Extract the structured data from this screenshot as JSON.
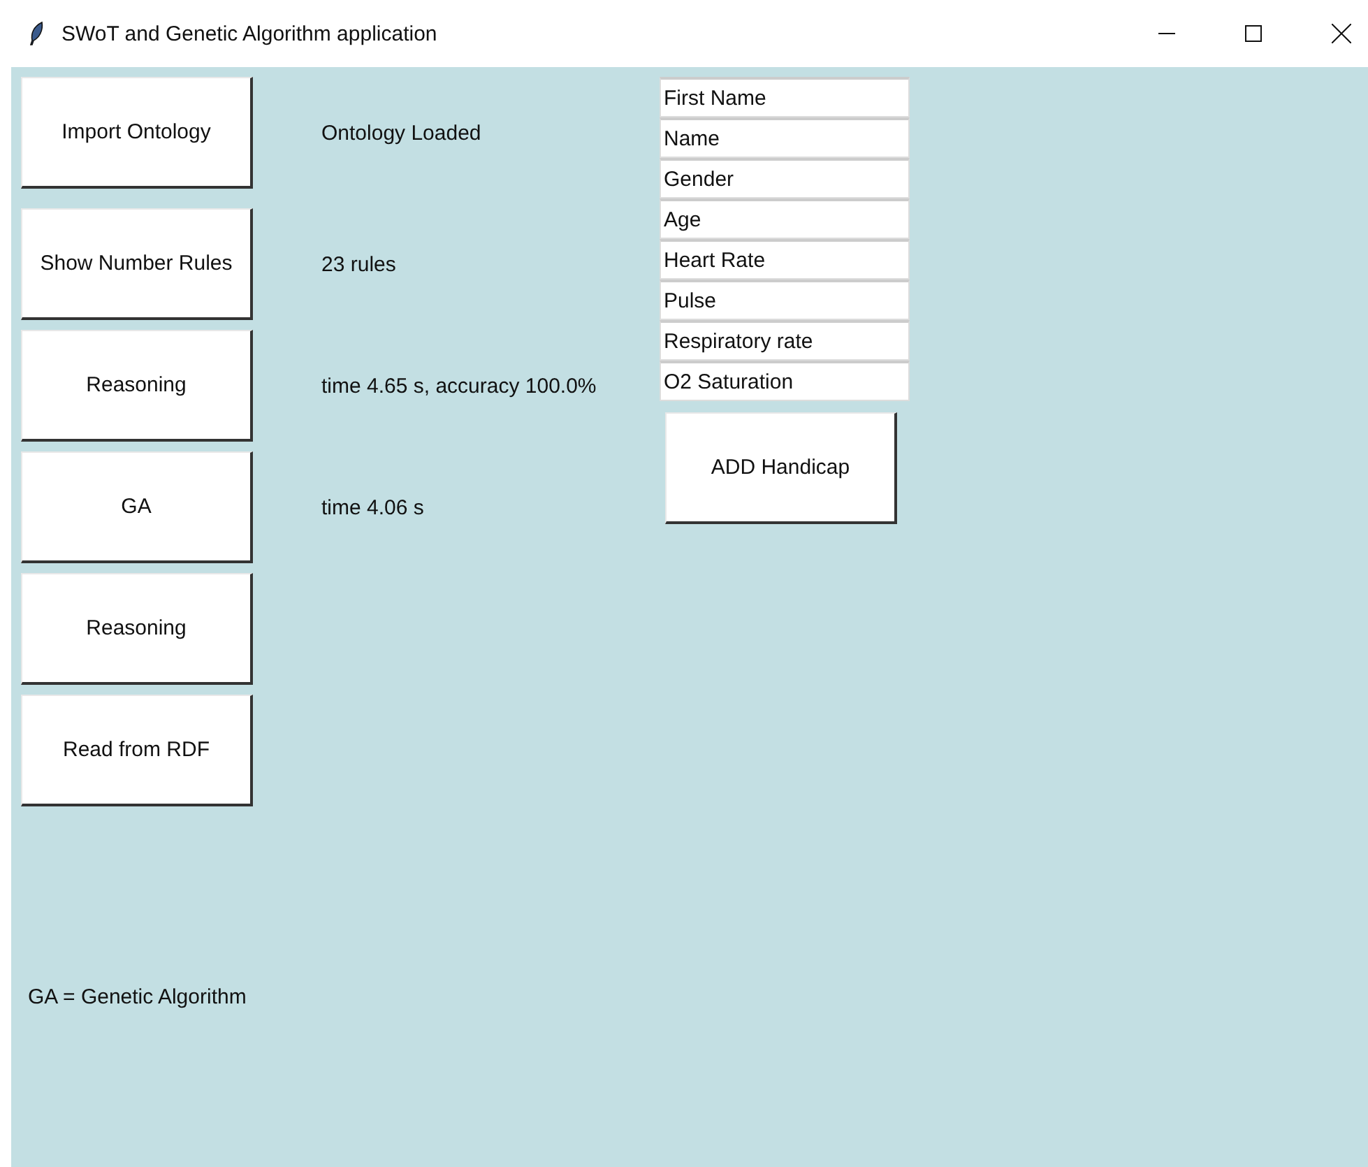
{
  "window": {
    "title": "SWoT and Genetic Algorithm application"
  },
  "actions": [
    {
      "label": "Import Ontology",
      "status": "Ontology Loaded"
    },
    {
      "label": "Show Number Rules",
      "status": "23 rules"
    },
    {
      "label": "Reasoning",
      "status": "time 4.65 s, accuracy 100.0%"
    },
    {
      "label": "GA",
      "status": "time 4.06 s"
    },
    {
      "label": "Reasoning"
    },
    {
      "label": "Read from RDF"
    }
  ],
  "fields": [
    {
      "value": "First Name"
    },
    {
      "value": "Name"
    },
    {
      "value": "Gender"
    },
    {
      "value": "Age"
    },
    {
      "value": "Heart Rate"
    },
    {
      "value": "Pulse"
    },
    {
      "value": "Respiratory rate"
    },
    {
      "value": "O2 Saturation"
    }
  ],
  "add_button": "ADD Handicap",
  "footnote": "GA = Genetic Algorithm"
}
